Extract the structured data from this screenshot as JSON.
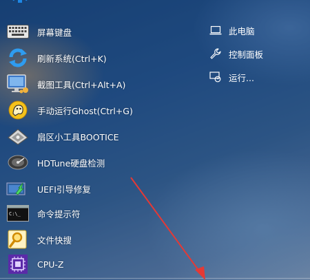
{
  "left_items": [
    {
      "label": "屏幕键盘",
      "icon": "keyboard-icon"
    },
    {
      "label": "刷新系统(Ctrl+K)",
      "icon": "refresh-icon"
    },
    {
      "label": "截图工具(Ctrl+Alt+A)",
      "icon": "screenshot-icon"
    },
    {
      "label": "手动运行Ghost(Ctrl+G)",
      "icon": "ghost-icon"
    },
    {
      "label": "扇区小工具BOOTICE",
      "icon": "disk-tool-icon"
    },
    {
      "label": "HDTune硬盘检测",
      "icon": "hard-disk-icon"
    },
    {
      "label": "UEFI引导修复",
      "icon": "uefi-repair-icon"
    },
    {
      "label": "命令提示符",
      "icon": "command-prompt-icon"
    },
    {
      "label": "文件快搜",
      "icon": "file-search-icon"
    },
    {
      "label": "CPU-Z",
      "icon": "cpu-icon"
    }
  ],
  "right_items": [
    {
      "label": "此电脑",
      "icon": "computer-icon"
    },
    {
      "label": "控制面板",
      "icon": "wrench-icon"
    },
    {
      "label": "运行...",
      "icon": "run-icon"
    }
  ],
  "colors": {
    "accent": "#2a5f9e",
    "arrow": "#e53935"
  }
}
